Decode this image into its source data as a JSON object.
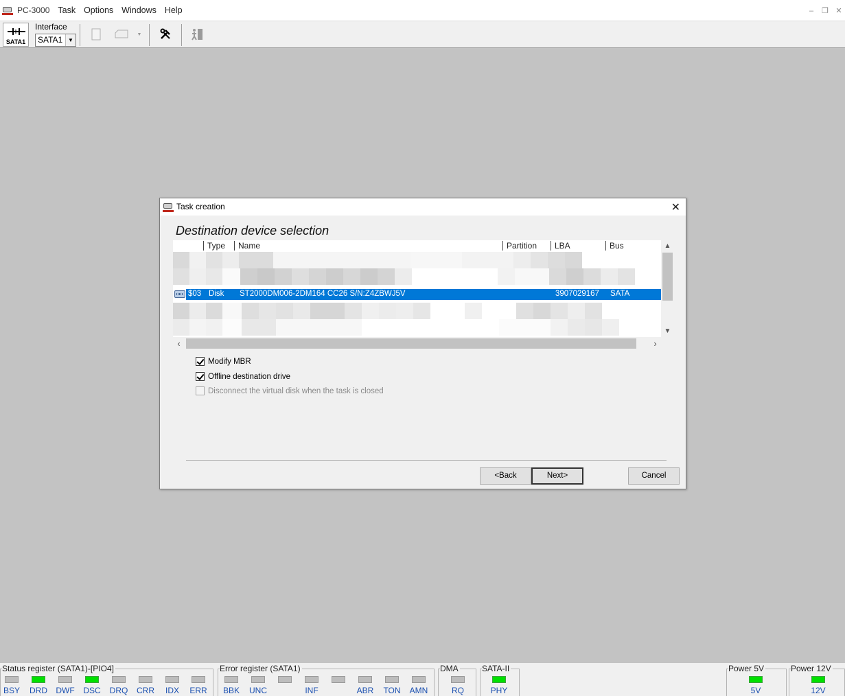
{
  "app": {
    "title": "PC-3000",
    "menu": [
      "Task",
      "Options",
      "Windows",
      "Help"
    ]
  },
  "toolbar": {
    "sata_label": "SATA1",
    "interface_label": "Interface",
    "interface_value": "SATA1"
  },
  "dialog": {
    "title": "Task creation",
    "heading": "Destination device selection",
    "columns": [
      "Type",
      "Name",
      "Partition",
      "LBA",
      "Bus"
    ],
    "selected_row": {
      "id": "$03",
      "type": "Disk",
      "name": "ST2000DM006-2DM164 CC26 S/N:Z4ZBWJ5V",
      "partition": "",
      "lba": "3907029167",
      "bus": "SATA"
    },
    "options": [
      {
        "label": "Modify MBR",
        "checked": true,
        "enabled": true
      },
      {
        "label": "Offline destination drive",
        "checked": true,
        "enabled": true
      },
      {
        "label": "Disconnect the virtual disk when the task is closed",
        "checked": false,
        "enabled": false
      }
    ],
    "buttons": {
      "back": "<Back",
      "next": "Next>",
      "cancel": "Cancel"
    },
    "selection_color": "#0078d7"
  },
  "statusbar": {
    "status_register": {
      "title": "Status register (SATA1)-[PIO4]",
      "leds": [
        {
          "label": "BSY",
          "on": false
        },
        {
          "label": "DRD",
          "on": true
        },
        {
          "label": "DWF",
          "on": false
        },
        {
          "label": "DSC",
          "on": true
        },
        {
          "label": "DRQ",
          "on": false
        },
        {
          "label": "CRR",
          "on": false
        },
        {
          "label": "IDX",
          "on": false
        },
        {
          "label": "ERR",
          "on": false
        }
      ]
    },
    "error_register": {
      "title": "Error register (SATA1)",
      "leds": [
        {
          "label": "BBK",
          "on": false
        },
        {
          "label": "UNC",
          "on": false
        },
        {
          "label": "",
          "on": false
        },
        {
          "label": "INF",
          "on": false
        },
        {
          "label": "",
          "on": false
        },
        {
          "label": "ABR",
          "on": false
        },
        {
          "label": "TON",
          "on": false
        },
        {
          "label": "AMN",
          "on": false
        }
      ]
    },
    "dma": {
      "title": "DMA",
      "leds": [
        {
          "label": "RQ",
          "on": false
        }
      ]
    },
    "sata2": {
      "title": "SATA-II",
      "leds": [
        {
          "label": "PHY",
          "on": true
        }
      ]
    },
    "power5": {
      "title": "Power 5V",
      "leds": [
        {
          "label": "5V",
          "on": true
        }
      ]
    },
    "power12": {
      "title": "Power 12V",
      "leds": [
        {
          "label": "12V",
          "on": true
        }
      ]
    },
    "led_on_color": "#00e000",
    "led_off_color": "#bdbdbd"
  }
}
